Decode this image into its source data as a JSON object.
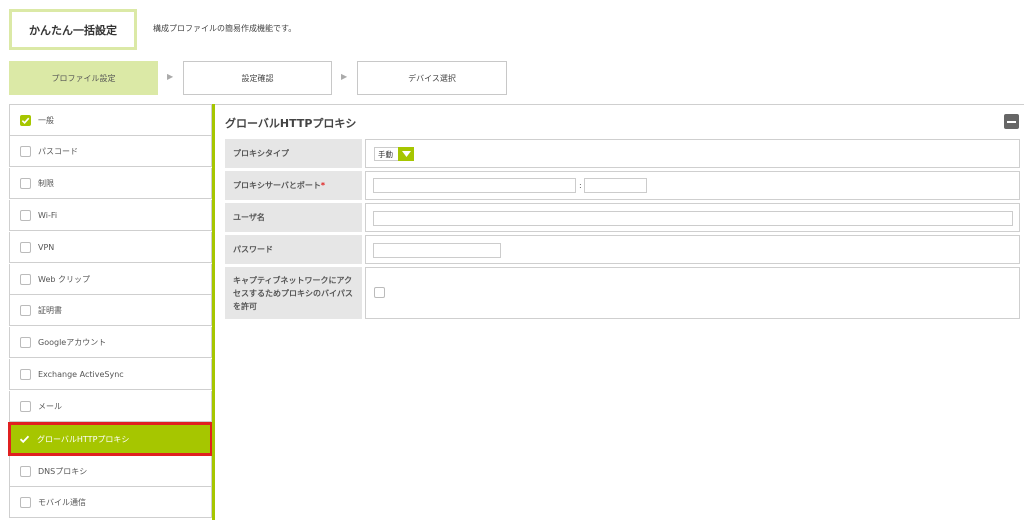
{
  "header": {
    "title": "かんたん一括設定",
    "subtitle": "構成プロファイルの簡易作成機能です。"
  },
  "steps": [
    {
      "label": "プロファイル設定",
      "active": true
    },
    {
      "label": "設定確認",
      "active": false
    },
    {
      "label": "デバイス選択",
      "active": false
    }
  ],
  "sidebar": {
    "items": [
      {
        "label": "一般",
        "checked": true
      },
      {
        "label": "パスコード",
        "checked": false
      },
      {
        "label": "制限",
        "checked": false
      },
      {
        "label": "Wi-Fi",
        "checked": false
      },
      {
        "label": "VPN",
        "checked": false
      },
      {
        "label": "Web クリップ",
        "checked": false
      },
      {
        "label": "証明書",
        "checked": false
      },
      {
        "label": "Googleアカウント",
        "checked": false
      },
      {
        "label": "Exchange ActiveSync",
        "checked": false
      },
      {
        "label": "メール",
        "checked": false
      },
      {
        "label": "グローバルHTTPプロキシ",
        "checked": true,
        "active": true
      },
      {
        "label": "DNSプロキシ",
        "checked": false
      },
      {
        "label": "モバイル通信",
        "checked": false
      }
    ]
  },
  "panel": {
    "title": "グローバルHTTPプロキシ",
    "proxy_type_label": "プロキシタイプ",
    "proxy_type_value": "手動",
    "proxy_server_label": "プロキシサーバとポート",
    "required_mark": "*",
    "port_separator": ":",
    "username_label": "ユーザ名",
    "password_label": "パスワード",
    "bypass_label": "キャプティブネットワークにアクセスするためプロキシのバイパスを許可"
  },
  "colors": {
    "accent": "#a6c600",
    "accent_light": "#dbe9a6",
    "highlight_border": "#e02020"
  }
}
